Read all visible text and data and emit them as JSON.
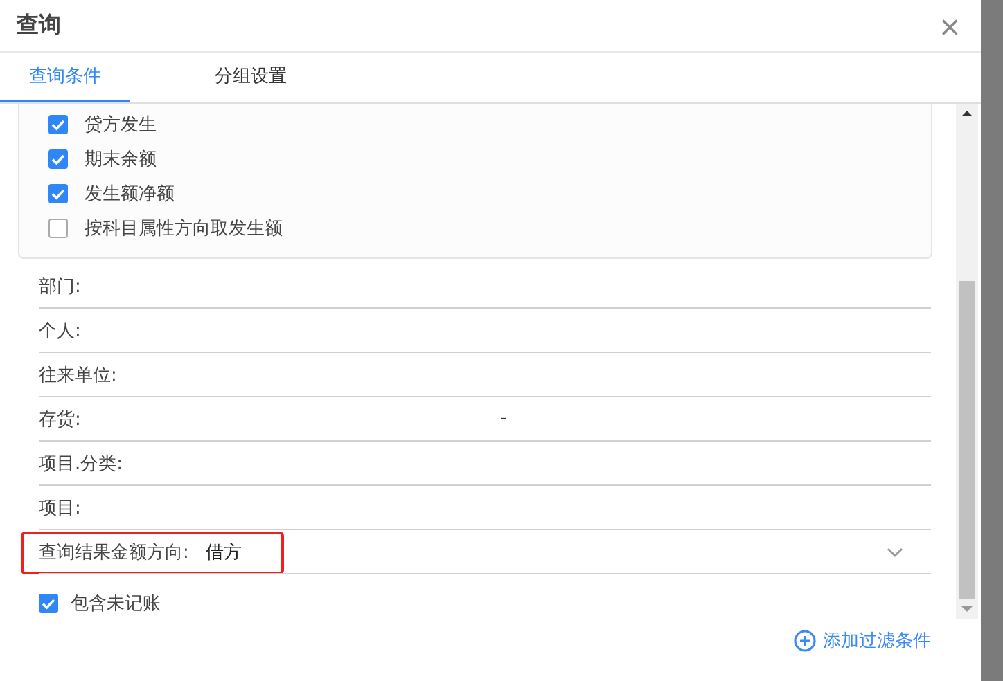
{
  "window": {
    "title": "查询",
    "close": "×"
  },
  "tabs": [
    {
      "label": "查询条件",
      "selected": true
    },
    {
      "label": "分组设置",
      "selected": false
    }
  ],
  "options": [
    {
      "label": "贷方发生",
      "checked": true
    },
    {
      "label": "期末余额",
      "checked": true
    },
    {
      "label": "发生额净额",
      "checked": true
    },
    {
      "label": "按科目属性方向取发生额",
      "checked": false
    }
  ],
  "fields": [
    {
      "kind": "text",
      "label": "部门:",
      "highlighted": false
    },
    {
      "kind": "text",
      "label": "个人:",
      "highlighted": false
    },
    {
      "kind": "text",
      "label": "往来单位:",
      "highlighted": false
    },
    {
      "kind": "text",
      "label": "存货:",
      "value": "-",
      "highlighted": false
    },
    {
      "kind": "text",
      "label": "项目.分类:",
      "highlighted": false
    },
    {
      "kind": "text",
      "label": "项目:",
      "highlighted": false
    },
    {
      "kind": "select",
      "label": "查询结果金额方向:",
      "value": "借方",
      "highlighted": true
    }
  ],
  "include_unposted": {
    "label": "包含未记账",
    "checked": true
  },
  "add_filter": {
    "label": "添加过滤条件"
  }
}
